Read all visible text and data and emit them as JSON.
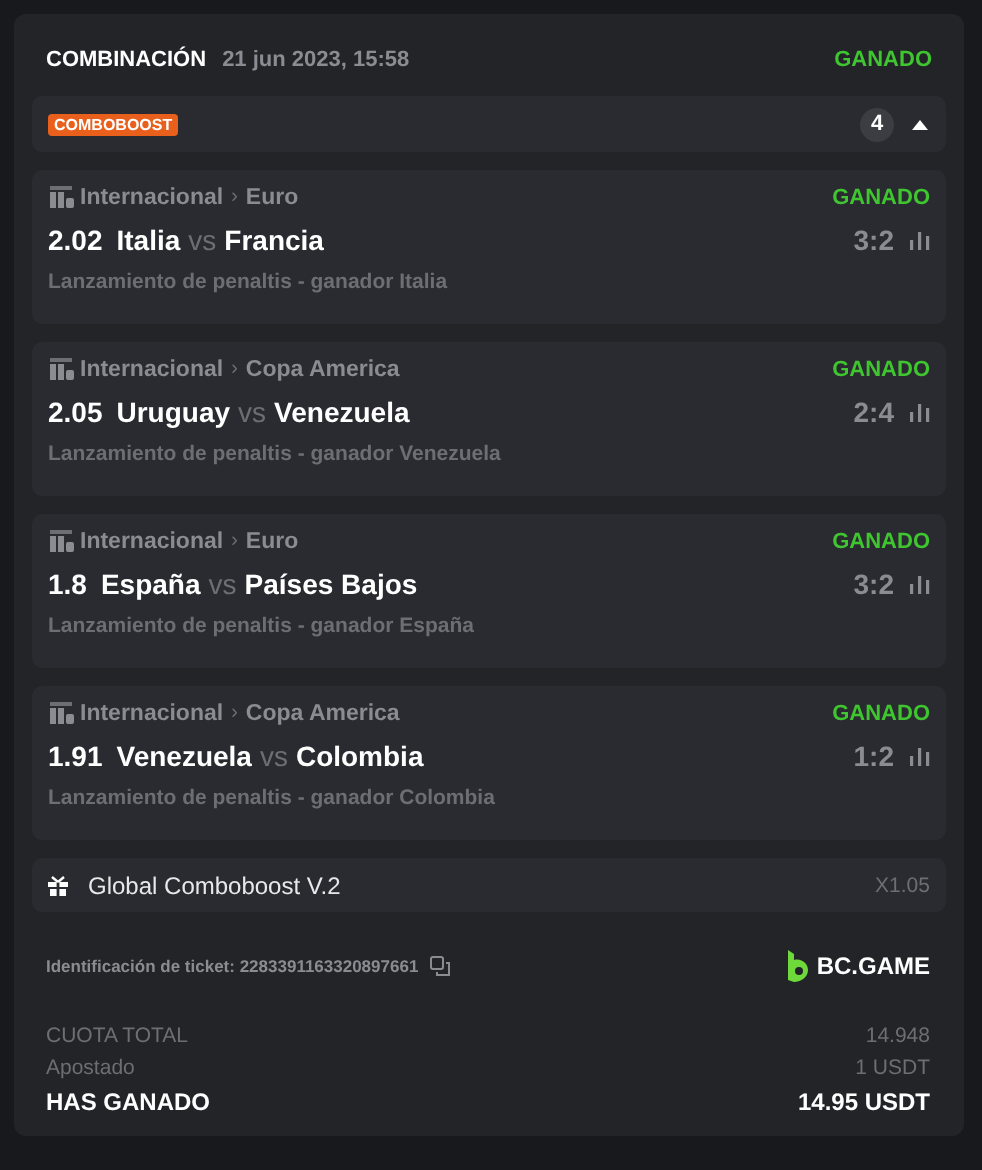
{
  "header": {
    "title": "COMBINACIÓN",
    "date": "21 jun 2023, 15:58",
    "status": "GANADO"
  },
  "boost_bar": {
    "tag": "COMBOBOOST",
    "count": "4",
    "expanded": true
  },
  "selections": [
    {
      "league": "Internacional",
      "separator": "›",
      "tournament": "Euro",
      "status": "GANADO",
      "odds": "2.02",
      "home": "Italia",
      "vs": "vs",
      "away": "Francia",
      "score": "3:2",
      "market": "Lanzamiento de penaltis - ganador Italia"
    },
    {
      "league": "Internacional",
      "separator": "›",
      "tournament": "Copa America",
      "status": "GANADO",
      "odds": "2.05",
      "home": "Uruguay",
      "vs": "vs",
      "away": "Venezuela",
      "score": "2:4",
      "market": "Lanzamiento de penaltis - ganador Venezuela"
    },
    {
      "league": "Internacional",
      "separator": "›",
      "tournament": "Euro",
      "status": "GANADO",
      "odds": "1.8",
      "home": "España",
      "vs": "vs",
      "away": "Países Bajos",
      "score": "3:2",
      "market": "Lanzamiento de penaltis - ganador España"
    },
    {
      "league": "Internacional",
      "separator": "›",
      "tournament": "Copa America",
      "status": "GANADO",
      "odds": "1.91",
      "home": "Venezuela",
      "vs": "vs",
      "away": "Colombia",
      "score": "1:2",
      "market": "Lanzamiento de penaltis - ganador Colombia"
    }
  ],
  "bonus": {
    "name": "Global Comboboost V.2",
    "multiplier": "X1.05"
  },
  "ticket": {
    "label": "Identificación de ticket: 2283391163320897661",
    "brand": "BC.GAME"
  },
  "summary": [
    {
      "kind": "muted",
      "label": "CUOTA TOTAL",
      "value": "14.948"
    },
    {
      "kind": "muted",
      "label": "Apostado",
      "value": "1 USDT"
    },
    {
      "kind": "total",
      "label": "HAS GANADO",
      "value": "14.95 USDT"
    }
  ]
}
